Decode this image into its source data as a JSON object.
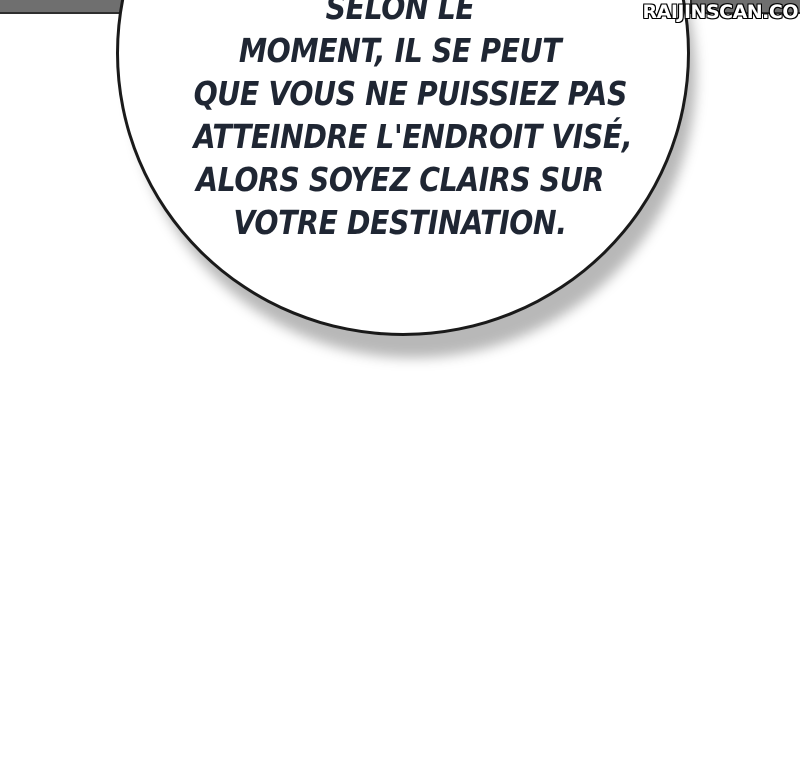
{
  "speech_bubble": {
    "lines": [
      "SELON LE",
      "MOMENT, IL SE PEUT",
      "QUE VOUS NE PUISSIEZ PAS",
      "ATTEINDRE L'ENDROIT VISÉ,",
      "ALORS SOYEZ CLAIRS SUR",
      "VOTRE DESTINATION."
    ]
  },
  "watermark": {
    "text": "RAIJINSCAN.CO"
  },
  "colors": {
    "text": "#1f2633",
    "bubble_border": "#1a1a1a",
    "panel_edge": "#6f6f6f",
    "background": "#ffffff"
  }
}
